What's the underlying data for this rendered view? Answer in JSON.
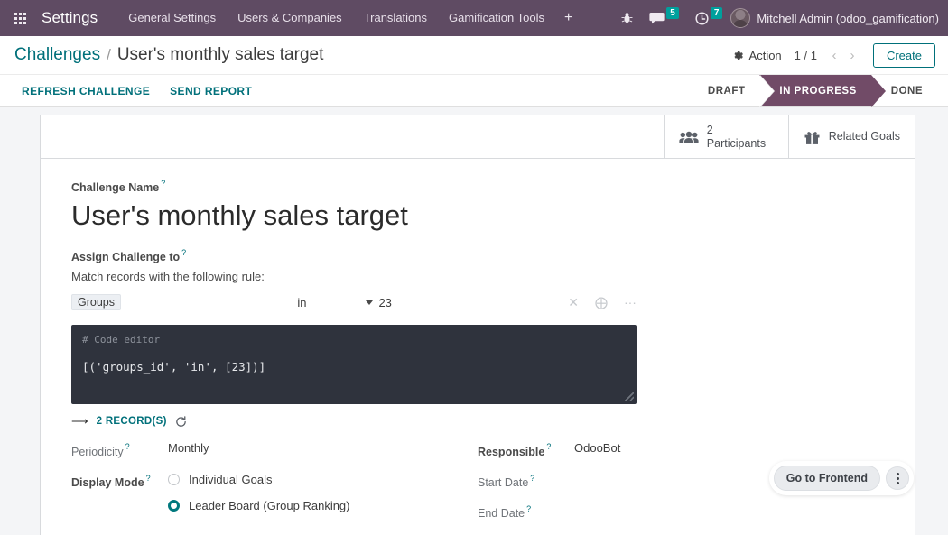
{
  "navbar": {
    "apps_icon": "apps-grid-icon",
    "brand": "Settings",
    "menu_items": [
      {
        "label": "General Settings"
      },
      {
        "label": "Users & Companies"
      },
      {
        "label": "Translations"
      },
      {
        "label": "Gamification Tools"
      }
    ],
    "add_label": "+",
    "systray": {
      "debug_icon": "bug-icon",
      "messages_icon": "messages-icon",
      "messages_count": "5",
      "activities_icon": "clock-icon",
      "activities_count": "7",
      "avatar_icon": "user-avatar",
      "user_name": "Mitchell Admin (odoo_gamification)"
    }
  },
  "control_panel": {
    "breadcrumb": {
      "parent": "Challenges",
      "separator": "/",
      "current": "User's monthly sales target"
    },
    "action_label": "Action",
    "action_icon": "gear-icon",
    "pager": "1 / 1",
    "prev_icon": "chevron-left-icon",
    "next_icon": "chevron-right-icon",
    "create_label": "Create",
    "buttons": [
      {
        "label": "REFRESH CHALLENGE"
      },
      {
        "label": "SEND REPORT"
      }
    ],
    "statusbar": {
      "stages": [
        {
          "label": "DRAFT",
          "active": false
        },
        {
          "label": "IN PROGRESS",
          "active": true
        },
        {
          "label": "DONE",
          "active": false
        }
      ],
      "active_color": "#714B67"
    }
  },
  "sheet": {
    "smart_buttons": [
      {
        "icon": "users-icon",
        "count": "2",
        "label": "Participants"
      },
      {
        "icon": "gift-icon",
        "count": "",
        "label": "Related Goals"
      }
    ],
    "challenge_name": {
      "label": "Challenge Name",
      "tooltip": "?",
      "value": "User's monthly sales target"
    },
    "assign_challenge": {
      "label": "Assign Challenge to",
      "tooltip": "?",
      "note": "Match records with the following rule:"
    },
    "domain_rule": {
      "field": "Groups",
      "operator": "in",
      "value": "23",
      "delete_icon": "times-icon",
      "add_icon": "plus-circle-icon",
      "more_icon": "ellipsis-icon"
    },
    "code_editor": {
      "comment": "# Code editor",
      "code": "[('groups_id', 'in', [23])]"
    },
    "records": {
      "arrow_icon": "arrow-right-icon",
      "link": "2 RECORD(S)",
      "refresh_icon": "refresh-icon"
    },
    "fields_left": {
      "periodicity": {
        "label": "Periodicity",
        "tooltip": "?",
        "value": "Monthly"
      },
      "display_mode": {
        "label": "Display Mode",
        "tooltip": "?",
        "options": [
          {
            "label": "Individual Goals",
            "selected": false
          },
          {
            "label": "Leader Board (Group Ranking)",
            "selected": true
          }
        ]
      }
    },
    "fields_right": {
      "responsible": {
        "label": "Responsible",
        "tooltip": "?",
        "value": "OdooBot"
      },
      "start_date": {
        "label": "Start Date",
        "tooltip": "?",
        "value": ""
      },
      "end_date": {
        "label": "End Date",
        "tooltip": "?",
        "value": ""
      }
    }
  },
  "frontend_fab": {
    "label": "Go to Frontend",
    "menu_icon": "vertical-dots-icon"
  }
}
